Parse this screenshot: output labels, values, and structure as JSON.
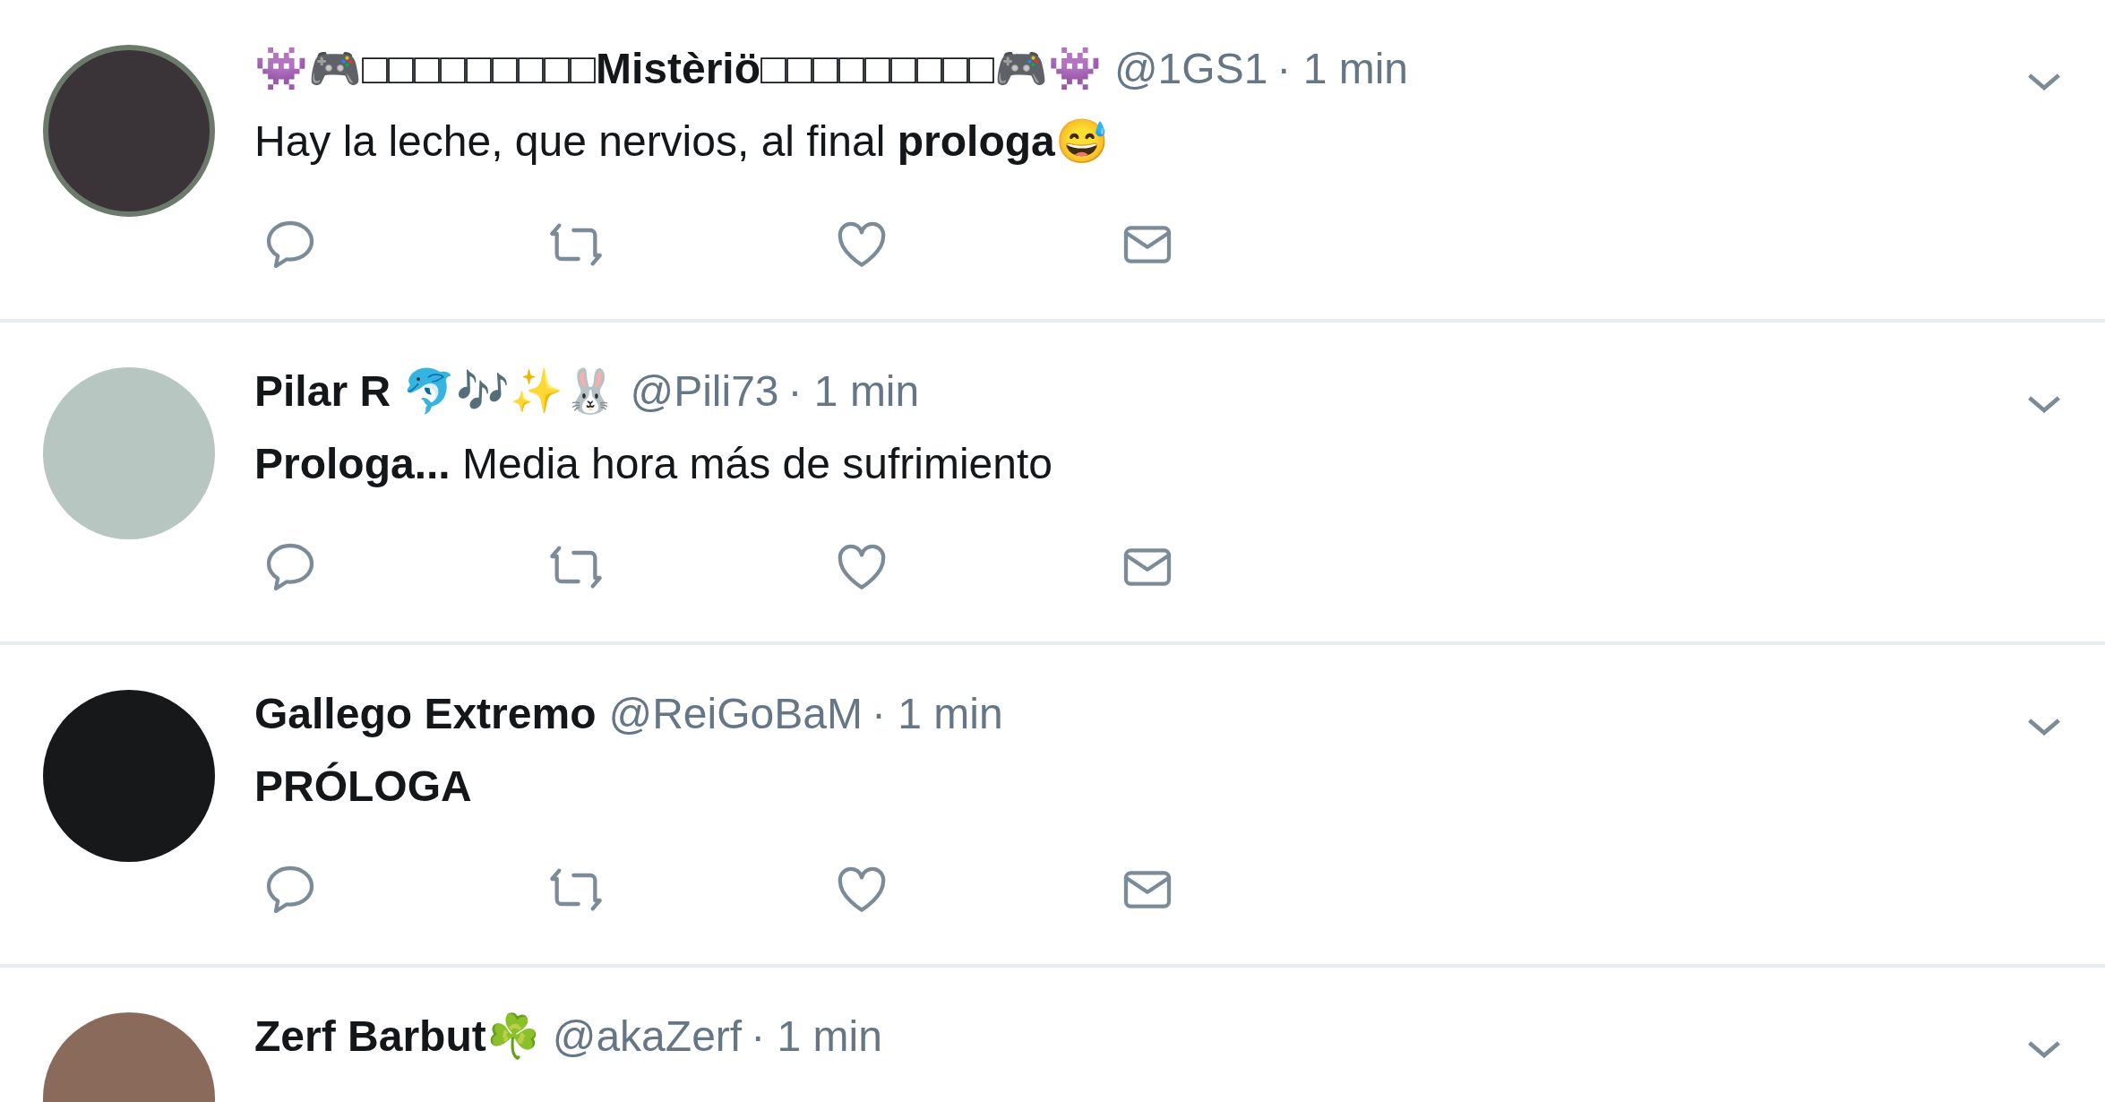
{
  "tweets": [
    {
      "name": "👾🎮□□□□□□□□□Mistèriö□□□□□□□□□🎮👾",
      "handle": "@1GS1",
      "time": "· 1 min",
      "text": "Hay la leche, que nervios, al final **prologa**😅"
    },
    {
      "name": "Pilar R 🐬🎶✨🐰",
      "handle": "@Pili73",
      "time": "· 1 min",
      "text": "**Prologa...** Media hora más de sufrimiento"
    },
    {
      "name": "Gallego Extremo",
      "handle": "@ReiGoBaM",
      "time": "· 1 min",
      "text": "**PRÓLOGA**"
    },
    {
      "name": "Zerf Barbut☘️",
      "handle": "@akaZerf",
      "time": "· 1 min"
    }
  ]
}
